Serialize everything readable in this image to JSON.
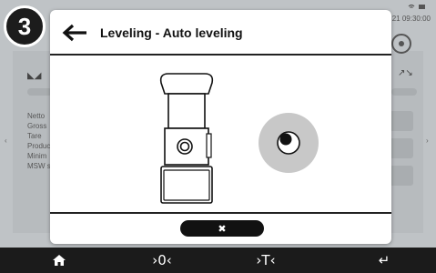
{
  "step": {
    "number": "3"
  },
  "background": {
    "status_time": "21  09:30:00",
    "labels": [
      "Netto",
      "Gross",
      "Tare",
      "Produc",
      "Minim",
      "MSW s"
    ],
    "left_glyph": "◣◢",
    "right_glyph": "↗↘"
  },
  "dialog": {
    "title": "Leveling - Auto leveling",
    "close_glyph": "✖"
  },
  "nav": {
    "home_glyph": "⌂",
    "zero_label": "›0‹",
    "tare_label": "›T‹",
    "enter_glyph": "↵"
  },
  "colors": {
    "badge": "#1c1c1c",
    "nav_bar": "#1b1b1b",
    "bubble": "#c8c8c8",
    "overlay_bg": "#c6c9cc"
  },
  "icons": {
    "back": "arrow-left-icon",
    "close": "close-icon",
    "device": "scale-device-illustration",
    "bubble": "level-bubble-icon"
  }
}
